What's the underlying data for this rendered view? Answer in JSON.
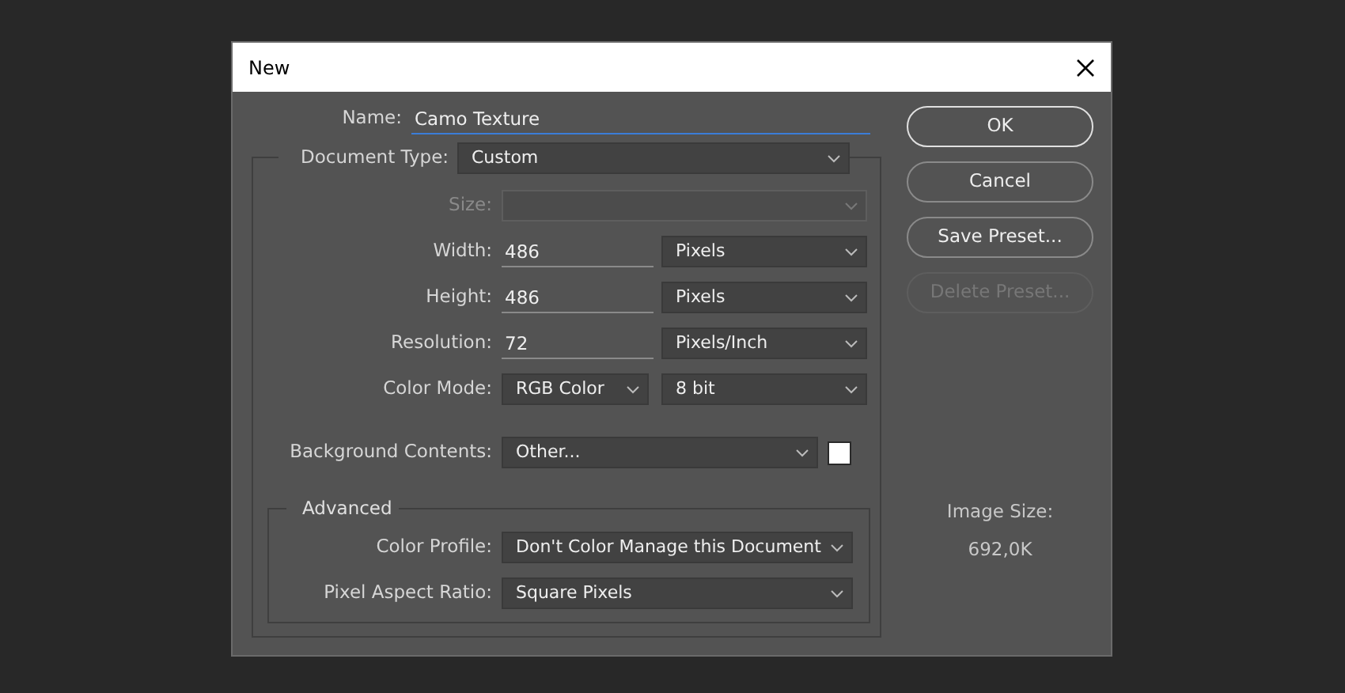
{
  "window": {
    "title": "New"
  },
  "name": {
    "label": "Name:",
    "value": "Camo Texture",
    "focused": true
  },
  "document_type": {
    "label": "Document Type:",
    "value": "Custom"
  },
  "fields": [
    {
      "kind": "select",
      "label": "Size:",
      "disabled": true
    },
    {
      "kind": "measure",
      "label": "Width:",
      "value": "486",
      "unit": "Pixels",
      "disabled": false
    },
    {
      "kind": "measure",
      "label": "Height:",
      "value": "486",
      "unit": "Pixels",
      "disabled": false
    },
    {
      "kind": "measure",
      "label": "Resolution:",
      "value": "72",
      "unit": "Pixels/Inch",
      "disabled": false
    },
    {
      "kind": "pair",
      "label": "Color Mode:",
      "value": "RGB Color",
      "unit": "8 bit",
      "disabled": false
    },
    {
      "kind": "swatch",
      "label": "Background Contents:",
      "value": "Other...",
      "color": "#ffffff",
      "disabled": false
    }
  ],
  "advanced": {
    "title": "Advanced",
    "fields": [
      {
        "label": "Color Profile:",
        "value": "Don't Color Manage this Document"
      },
      {
        "label": "Pixel Aspect Ratio:",
        "value": "Square Pixels"
      }
    ]
  },
  "buttons": [
    {
      "label": "OK",
      "default": true,
      "disabled": false
    },
    {
      "label": "Cancel",
      "default": false,
      "disabled": false
    },
    {
      "label": "Save Preset...",
      "default": false,
      "disabled": false
    },
    {
      "label": "Delete Preset...",
      "default": false,
      "disabled": true
    }
  ],
  "image_size": {
    "label": "Image Size:",
    "value": "692,0K"
  }
}
